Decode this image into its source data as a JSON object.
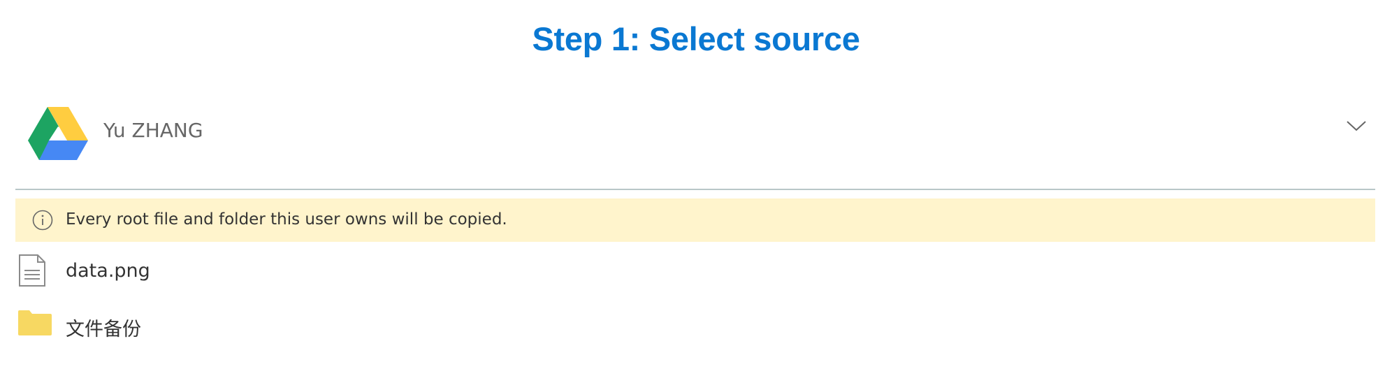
{
  "header": {
    "title": "Step 1: Select source"
  },
  "account": {
    "name": "Yu ZHANG",
    "icon": "google-drive-icon"
  },
  "notice": {
    "icon": "info-icon",
    "text": "Every root file and folder this user owns will be copied."
  },
  "items": [
    {
      "name": "data.png",
      "icon": "file-icon"
    },
    {
      "name": "文件备份",
      "icon": "folder-icon"
    }
  ],
  "colors": {
    "title": "#0a78d2",
    "notice_bg": "#fff4cc",
    "folder": "#f7d862",
    "divider": "#b9c7c8"
  }
}
